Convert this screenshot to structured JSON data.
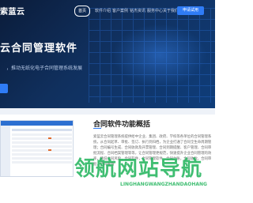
{
  "brand": {
    "logo_text": "索蓝云"
  },
  "nav": {
    "items": [
      {
        "label": "首页",
        "active": true
      },
      {
        "label": "软件介绍",
        "active": false
      },
      {
        "label": "客户案例",
        "active": false
      },
      {
        "label": "铭杰资讯",
        "active": false
      },
      {
        "label": "服务中心",
        "active": false
      },
      {
        "label": "关于我们",
        "active": false
      }
    ],
    "cta_label": "申请试用"
  },
  "hero": {
    "title": "云合同管理软件",
    "subtitle": "，推动无纸化电子合同管理系统发展"
  },
  "feature": {
    "title": "合同软件功能概括",
    "body": "索蓝云合同管理系统提供给中企业、集团、政府、学校等各单位的合同管理系统，从合同起草、审批、签订、执行到归档，为企业打通了合同全生命周期管理；合同编号生成、合同收款及开票管理、合同到期提醒、客户管理、合同审批流程、合同档案管理等等，让合同管理更规范，快速提升企业合同管理的效率，降低合同风险，合同软件，合同管理软件，合同台账，合同收款，合同审批，合同查询"
  },
  "watermark": {
    "text": "领航网站导航",
    "sub": "LINGHANGWANGZHANDAOHANG"
  },
  "colors": {
    "accent": "#2f7cf6",
    "hero_bg": "#10305e",
    "watermark": "#1fb35a"
  }
}
